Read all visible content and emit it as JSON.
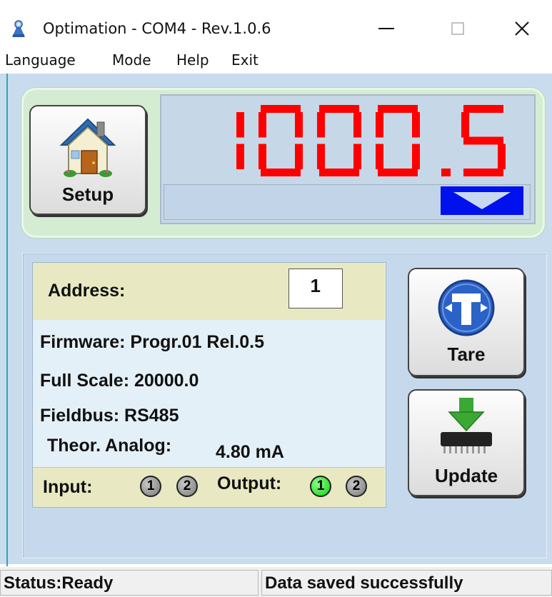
{
  "window": {
    "title": "Optimation - COM4 - Rev.1.0.6",
    "minimize_icon": "minimize-icon",
    "maximize_icon": "maximize-icon",
    "close_icon": "close-icon"
  },
  "menu": {
    "items": [
      {
        "label": "Language"
      },
      {
        "label": "Mode"
      },
      {
        "label": "Help"
      },
      {
        "label": "Exit"
      }
    ]
  },
  "display": {
    "value": "1000.5",
    "digit_color": "#ff0000",
    "indicator_icon": "down-triangle-icon"
  },
  "buttons": {
    "setup_label": "Setup",
    "tare_label": "Tare",
    "update_label": "Update"
  },
  "device": {
    "address_label": "Address:",
    "address_value": "1",
    "firmware": "Firmware: Progr.01 Rel.0.5",
    "full_scale": "Full Scale: 20000.0",
    "fieldbus": "Fieldbus: RS485",
    "analog_label": "Theor. Analog:",
    "analog_value": "4.80 mA"
  },
  "io": {
    "input_label": "Input:",
    "output_label": "Output:",
    "inputs": [
      {
        "label": "1",
        "active": false
      },
      {
        "label": "2",
        "active": false
      }
    ],
    "outputs": [
      {
        "label": "1",
        "active": true
      },
      {
        "label": "2",
        "active": false
      }
    ],
    "active_color": "#00dd00"
  },
  "status": {
    "left": "Status:Ready",
    "right": "Data saved successfully"
  }
}
